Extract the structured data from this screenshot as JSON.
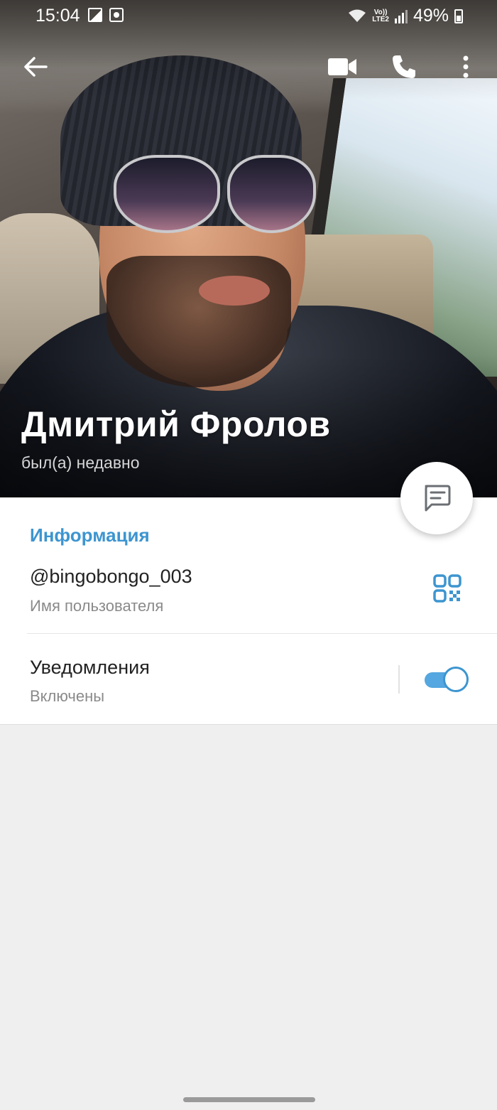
{
  "status_bar": {
    "time": "15:04",
    "network": "LTE2",
    "volte": "Vo))",
    "battery": "49%"
  },
  "profile": {
    "name": "Дмитрий Фролов",
    "last_seen": "был(а) недавно"
  },
  "info": {
    "section_title": "Информация",
    "username": "@bingobongo_003",
    "username_label": "Имя пользователя",
    "notifications_title": "Уведомления",
    "notifications_state": "Включены",
    "notifications_enabled": true
  },
  "colors": {
    "accent": "#3d95d0",
    "toggle_track": "#54a7e0",
    "background": "#efefef"
  },
  "icons": {
    "back": "arrow-left-icon",
    "video": "video-camera-icon",
    "call": "phone-icon",
    "more": "more-vertical-icon",
    "message": "message-icon",
    "qr": "qr-code-icon"
  }
}
